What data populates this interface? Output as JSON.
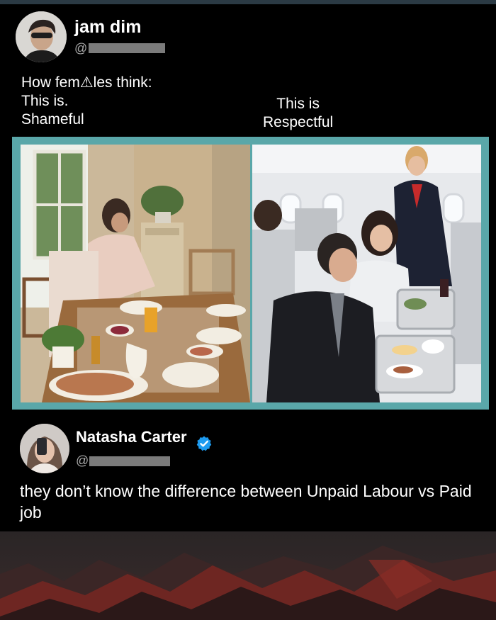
{
  "post": {
    "author": {
      "name": "jam dim",
      "handle": "@"
    },
    "text_left": [
      "How fem⚠les think:",
      "This is.",
      "Shameful"
    ],
    "text_right": [
      "This is",
      "Respectful"
    ]
  },
  "reply": {
    "author": {
      "name": "Natasha Carter",
      "handle": "@",
      "verified": true
    },
    "text": "they don’t know the difference between Unpaid Labour vs Paid job"
  },
  "icons": {
    "verified_badge": "verified-badge-icon"
  },
  "colors": {
    "image_border": "#5aa7a9",
    "verified_blue": "#1d9bf0",
    "background": "#000000"
  }
}
